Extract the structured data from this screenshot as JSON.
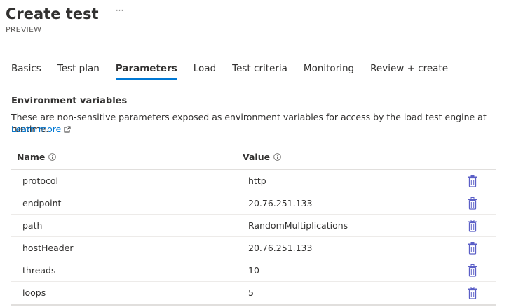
{
  "header": {
    "title": "Create test",
    "more_label": "···",
    "subtitle": "PREVIEW"
  },
  "tabs": [
    {
      "label": "Basics",
      "active": false
    },
    {
      "label": "Test plan",
      "active": false
    },
    {
      "label": "Parameters",
      "active": true
    },
    {
      "label": "Load",
      "active": false
    },
    {
      "label": "Test criteria",
      "active": false
    },
    {
      "label": "Monitoring",
      "active": false
    },
    {
      "label": "Review + create",
      "active": false
    }
  ],
  "section": {
    "title": "Environment variables",
    "description": "These are non-sensitive parameters exposed as environment variables for access by the load test engine at runtime.",
    "learn_more": "Learn more"
  },
  "table": {
    "columns": [
      {
        "label": "Name",
        "icon": "info-icon"
      },
      {
        "label": "Value",
        "icon": "info-icon"
      }
    ],
    "rows": [
      {
        "name": "protocol",
        "value": "http",
        "action_icon": "trash-icon"
      },
      {
        "name": "endpoint",
        "value": "20.76.251.133",
        "action_icon": "trash-icon"
      },
      {
        "name": "path",
        "value": "RandomMultiplications",
        "action_icon": "trash-icon"
      },
      {
        "name": "hostHeader",
        "value": "20.76.251.133",
        "action_icon": "trash-icon"
      },
      {
        "name": "threads",
        "value": "10",
        "action_icon": "trash-icon"
      },
      {
        "name": "loops",
        "value": "5",
        "action_icon": "trash-icon"
      }
    ]
  },
  "colors": {
    "accent": "#0078d4",
    "text": "#323130",
    "muted": "#605e5c",
    "divider": "#edebe9",
    "delete_icon": "#5b5fc7"
  }
}
